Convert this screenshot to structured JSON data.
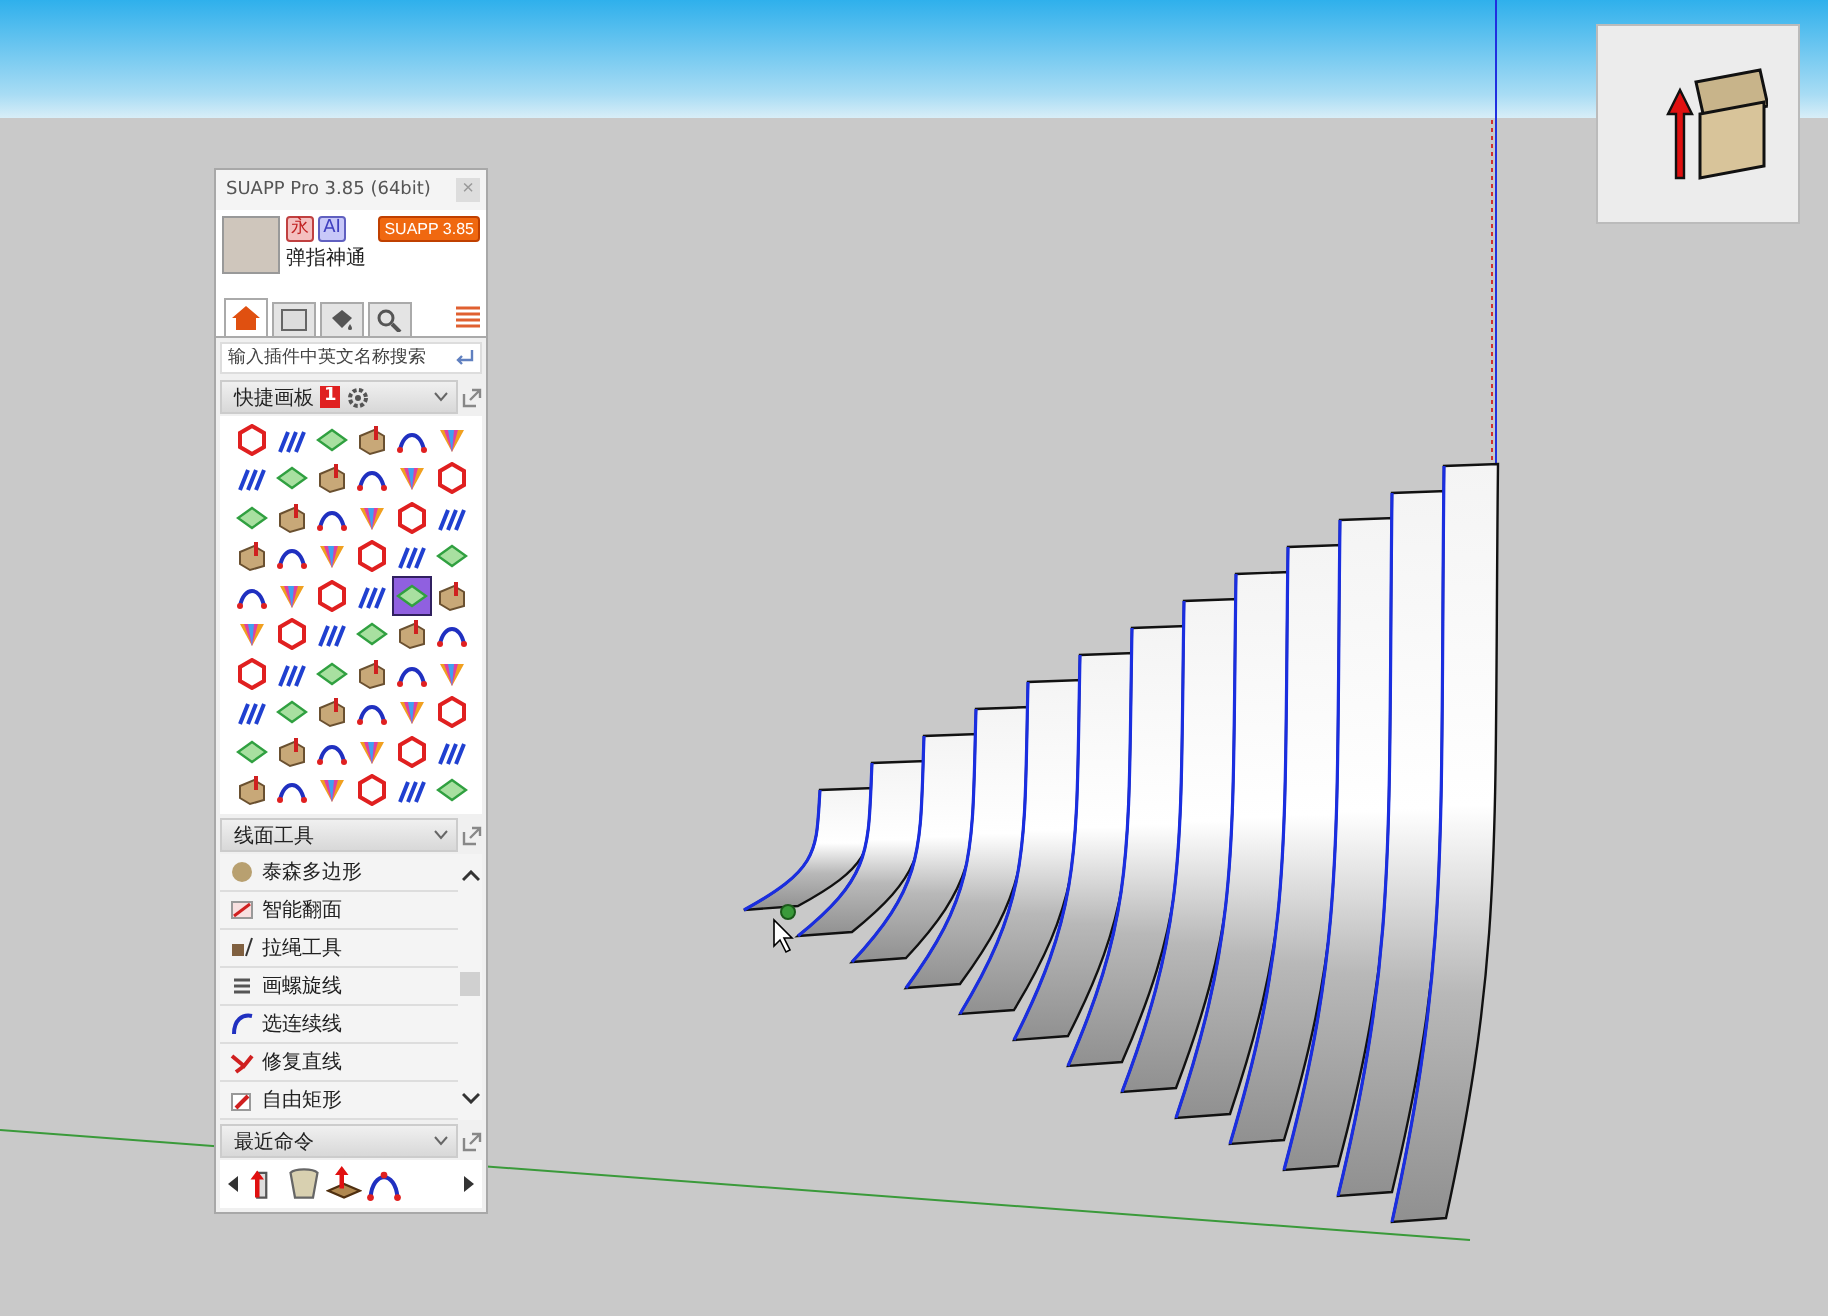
{
  "panel": {
    "title": "SUAPP Pro 3.85 (64bit)",
    "close": "×",
    "user": {
      "name": "弹指神通",
      "badges": [
        "永",
        "AI"
      ],
      "version_button": "SUAPP 3.85"
    },
    "tabs": [
      {
        "selected": true
      },
      {
        "selected": false
      },
      {
        "selected": false
      },
      {
        "selected": false
      }
    ],
    "search": {
      "placeholder": "输入插件中英文名称搜索"
    },
    "quick_panel": {
      "title": "快捷画板",
      "badge": "1",
      "icons": [
        {
          "selected": false
        },
        {
          "selected": false
        },
        {
          "selected": false
        },
        {
          "selected": false
        },
        {
          "selected": false
        },
        {
          "selected": false
        },
        {
          "selected": false
        },
        {
          "selected": false
        },
        {
          "selected": false
        },
        {
          "selected": false
        },
        {
          "selected": false
        },
        {
          "selected": false
        },
        {
          "selected": false
        },
        {
          "selected": false
        },
        {
          "selected": false
        },
        {
          "selected": false
        },
        {
          "selected": false
        },
        {
          "selected": false
        },
        {
          "selected": false
        },
        {
          "selected": false
        },
        {
          "selected": false
        },
        {
          "selected": false
        },
        {
          "selected": false
        },
        {
          "selected": false
        },
        {
          "selected": false
        },
        {
          "selected": false
        },
        {
          "selected": false
        },
        {
          "selected": false
        },
        {
          "selected": true
        },
        {
          "selected": false
        },
        {
          "selected": false
        },
        {
          "selected": false
        },
        {
          "selected": false
        },
        {
          "selected": false
        },
        {
          "selected": false
        },
        {
          "selected": false
        },
        {
          "selected": false
        },
        {
          "selected": false
        },
        {
          "selected": false
        },
        {
          "selected": false
        },
        {
          "selected": false
        },
        {
          "selected": false
        },
        {
          "selected": false
        },
        {
          "selected": false
        },
        {
          "selected": false
        },
        {
          "selected": false
        },
        {
          "selected": false
        },
        {
          "selected": false
        },
        {
          "selected": false
        },
        {
          "selected": false
        },
        {
          "selected": false
        },
        {
          "selected": false
        },
        {
          "selected": false
        },
        {
          "selected": false
        },
        {
          "selected": false
        },
        {
          "selected": false
        },
        {
          "selected": false
        },
        {
          "selected": false
        },
        {
          "selected": false
        },
        {
          "selected": false
        }
      ]
    },
    "line_tools": {
      "title": "线面工具",
      "items": [
        "泰森多边形",
        "智能翻面",
        "拉绳工具",
        "画螺旋线",
        "选连续线",
        "修复直线",
        "自由矩形"
      ]
    },
    "recent": {
      "title": "最近命令",
      "icons": [
        {
          "kind": "pushpull"
        },
        {
          "kind": "shell"
        },
        {
          "kind": "lift"
        },
        {
          "kind": "curve"
        }
      ]
    }
  }
}
